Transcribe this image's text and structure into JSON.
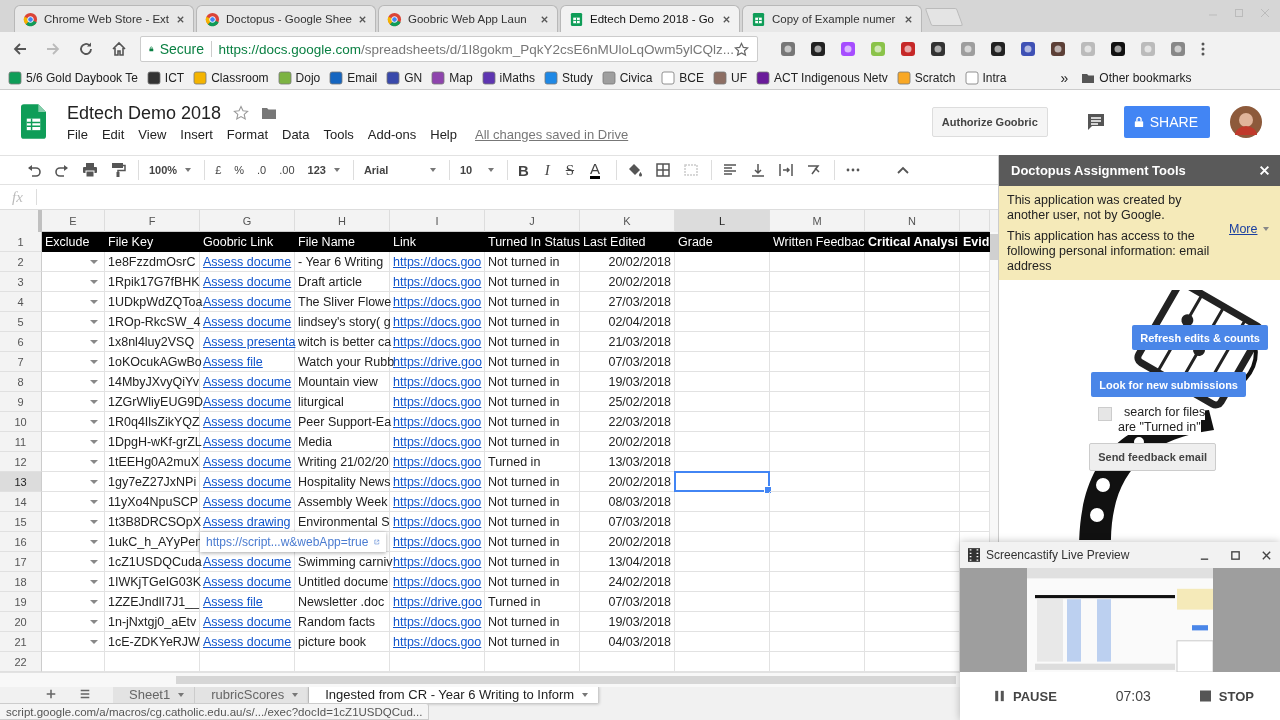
{
  "browser": {
    "tabs": [
      {
        "title": "Chrome Web Store - Ext",
        "kind": "store",
        "selected": false
      },
      {
        "title": "Doctopus - Google Shee",
        "kind": "store",
        "selected": false
      },
      {
        "title": "Goobric Web App Laun",
        "kind": "store",
        "selected": false
      },
      {
        "title": "Edtech Demo 2018 - Go",
        "kind": "sheets",
        "selected": true
      },
      {
        "title": "Copy of Example numer",
        "kind": "sheets",
        "selected": false
      }
    ],
    "address": {
      "secure_label": "Secure",
      "url_host": "https://docs.google.com",
      "url_path": "/spreadsheets/d/1I8gokm_PqkY2csE6nMUloLqOwm5ylCQlz..."
    },
    "bookmarks": [
      {
        "label": "5/6 Gold Daybook Te",
        "color": "#0f9d58"
      },
      {
        "label": "ICT",
        "color": "#333333"
      },
      {
        "label": "Classroom",
        "color": "#f4b400"
      },
      {
        "label": "Dojo",
        "color": "#7cb342"
      },
      {
        "label": "Email",
        "color": "#1565c0"
      },
      {
        "label": "GN",
        "color": "#3949ab"
      },
      {
        "label": "Map",
        "color": "#8e44ad"
      },
      {
        "label": "iMaths",
        "color": "#5e35b1"
      },
      {
        "label": "Study",
        "color": "#1e88e5"
      },
      {
        "label": "Civica",
        "color": "#9e9e9e"
      },
      {
        "label": "BCE",
        "color": "#ffffff"
      },
      {
        "label": "UF",
        "color": "#8d6e63"
      },
      {
        "label": "ACT Indigenous Netv",
        "color": "#6a1b9a"
      },
      {
        "label": "Scratch",
        "color": "#f9a825"
      },
      {
        "label": "Intra",
        "color": "#ffffff"
      }
    ],
    "bookmarks_more": "»",
    "other_bookmarks": "Other bookmarks"
  },
  "doc": {
    "title": "Edtech Demo 2018",
    "menu": [
      "File",
      "Edit",
      "View",
      "Insert",
      "Format",
      "Data",
      "Tools",
      "Add-ons",
      "Help"
    ],
    "save_status": "All changes saved in Drive",
    "authorize_button": "Authorize Goobric",
    "share_button": "SHARE"
  },
  "toolbar": {
    "zoom": "100%",
    "currency": "£",
    "percent": "%",
    "decrease_decimals": ".0",
    "increase_decimals": ".00",
    "number_format": "123",
    "font": "Arial",
    "font_size": "10",
    "bold": "B",
    "italic": "I",
    "strikethrough": "S",
    "text_color": "A"
  },
  "formula_bar": {
    "label": "fx"
  },
  "sheet": {
    "columns": [
      {
        "letter": "E",
        "selected": false
      },
      {
        "letter": "F",
        "selected": false
      },
      {
        "letter": "G",
        "selected": false
      },
      {
        "letter": "H",
        "selected": false
      },
      {
        "letter": "I",
        "selected": false
      },
      {
        "letter": "J",
        "selected": false
      },
      {
        "letter": "K",
        "selected": false
      },
      {
        "letter": "L",
        "selected": true
      },
      {
        "letter": "M",
        "selected": false
      },
      {
        "letter": "N",
        "selected": false
      }
    ],
    "header": {
      "number": "1",
      "cells": [
        {
          "text": "Exclude",
          "bold": false
        },
        {
          "text": "File Key",
          "bold": false
        },
        {
          "text": "Goobric Link",
          "bold": false
        },
        {
          "text": "File Name",
          "bold": false
        },
        {
          "text": "Link",
          "bold": false
        },
        {
          "text": "Turned In Status",
          "bold": false
        },
        {
          "text": "Last Edited",
          "bold": false
        },
        {
          "text": "Grade",
          "bold": false
        },
        {
          "text": "Written Feedbac",
          "bold": false
        },
        {
          "text": "Critical Analysi",
          "bold": true
        },
        {
          "text": "Evid",
          "bold": true
        }
      ]
    },
    "rows": [
      {
        "number": "2",
        "selected": false,
        "file_key": "1e8FzzdmOsrC",
        "goobric_link": "Assess docume",
        "file_name": "- Year 6 Writing",
        "link": "https://docs.goo",
        "status": "Not turned in",
        "last_edited": "20/02/2018"
      },
      {
        "number": "3",
        "selected": false,
        "file_key": "1Rpik17G7fBHK",
        "goobric_link": "Assess docume",
        "file_name": "Draft article",
        "link": "https://docs.goo",
        "status": "Not turned in",
        "last_edited": "20/02/2018"
      },
      {
        "number": "4",
        "selected": false,
        "file_key": "1UDkpWdZQToa",
        "goobric_link": "Assess docume",
        "file_name": "The Sliver Flowe",
        "link": "https://docs.goo",
        "status": "Not turned in",
        "last_edited": "27/03/2018"
      },
      {
        "number": "5",
        "selected": false,
        "file_key": "1ROp-RkcSW_4",
        "goobric_link": "Assess docume",
        "file_name": "lindsey's story( g",
        "link": "https://docs.goo",
        "status": "Not turned in",
        "last_edited": "02/04/2018"
      },
      {
        "number": "6",
        "selected": false,
        "file_key": "1x8nl4luy2VSQ",
        "goobric_link": "Assess presenta",
        "file_name": "witch is better ca",
        "link": "https://docs.goo",
        "status": "Not turned in",
        "last_edited": "21/03/2018"
      },
      {
        "number": "7",
        "selected": false,
        "file_key": "1oKOcukAGwBo",
        "goobric_link": "Assess file",
        "file_name": "Watch your Rubb",
        "link": "https://drive.goo",
        "status": "Not turned in",
        "last_edited": "07/03/2018"
      },
      {
        "number": "8",
        "selected": false,
        "file_key": "14MbyJXvyQiYv",
        "goobric_link": "Assess docume",
        "file_name": "Mountain view",
        "link": "https://docs.goo",
        "status": "Not turned in",
        "last_edited": "19/03/2018"
      },
      {
        "number": "9",
        "selected": false,
        "file_key": "1ZGrWliyEUG9D",
        "goobric_link": "Assess docume",
        "file_name": "liturgical",
        "link": "https://docs.goo",
        "status": "Not turned in",
        "last_edited": "25/02/2018"
      },
      {
        "number": "10",
        "selected": false,
        "file_key": "1R0q4IlsZikYQZ",
        "goobric_link": "Assess docume",
        "file_name": "Peer Support-Ea",
        "link": "https://docs.goo",
        "status": "Not turned in",
        "last_edited": "22/03/2018"
      },
      {
        "number": "11",
        "selected": false,
        "file_key": "1DpgH-wKf-grZL",
        "goobric_link": "Assess docume",
        "file_name": "Media",
        "link": "https://docs.goo",
        "status": "Not turned in",
        "last_edited": "20/02/2018"
      },
      {
        "number": "12",
        "selected": false,
        "file_key": "1tEEHg0A2muX",
        "goobric_link": "Assess docume",
        "file_name": "Writing 21/02/20",
        "link": "https://docs.goo",
        "status": "Turned in",
        "last_edited": "13/03/2018"
      },
      {
        "number": "13",
        "selected": true,
        "file_key": "1gy7eZ27JxNPi",
        "goobric_link": "Assess docume",
        "file_name": "Hospitality News",
        "link": "https://docs.goo",
        "status": "Not turned in",
        "last_edited": "20/02/2018"
      },
      {
        "number": "14",
        "selected": false,
        "file_key": "11yXo4NpuSCP",
        "goobric_link": "Assess docume",
        "file_name": "Assembly Week",
        "link": "https://docs.goo",
        "status": "Not turned in",
        "last_edited": "08/03/2018"
      },
      {
        "number": "15",
        "selected": false,
        "file_key": "1t3B8DRCSOpX",
        "goobric_link": "Assess drawing",
        "file_name": "Environmental S",
        "link": "https://docs.goo",
        "status": "Not turned in",
        "last_edited": "07/03/2018"
      },
      {
        "number": "16",
        "selected": false,
        "file_key": "1ukC_h_AYyPen",
        "link": "https://docs.goo",
        "status": "Not turned in",
        "last_edited": "20/02/2018"
      },
      {
        "number": "17",
        "selected": false,
        "file_key": "1cZ1USDQCuda",
        "goobric_link": "Assess docume",
        "file_name": "Swimming carniv",
        "link": "https://docs.goo",
        "status": "Not turned in",
        "last_edited": "13/04/2018"
      },
      {
        "number": "18",
        "selected": false,
        "file_key": "1IWKjTGeIG03K",
        "goobric_link": "Assess docume",
        "file_name": "Untitled docume",
        "link": "https://docs.goo",
        "status": "Not turned in",
        "last_edited": "24/02/2018"
      },
      {
        "number": "19",
        "selected": false,
        "file_key": "1ZZEJndlI7J1__",
        "goobric_link": "Assess file",
        "file_name": "Newsletter .doc",
        "link": "https://drive.goo",
        "status": "Turned in",
        "last_edited": "07/03/2018"
      },
      {
        "number": "20",
        "selected": false,
        "file_key": "1n-jNxtgj0_aEtv",
        "goobric_link": "Assess docume",
        "file_name": "Random facts",
        "link": "https://docs.goo",
        "status": "Not turned in",
        "last_edited": "19/03/2018"
      },
      {
        "number": "21",
        "selected": false,
        "file_key": "1cE-ZDKYeRJW",
        "goobric_link": "Assess docume",
        "file_name": "picture book",
        "link": "https://docs.goo",
        "status": "Not turned in",
        "last_edited": "04/03/2018"
      }
    ],
    "empty_rows": [
      "22"
    ],
    "link_popup": {
      "url": "https://script...w&webApp=true"
    }
  },
  "sheet_tabs": [
    {
      "label": "Sheet1",
      "selected": false
    },
    {
      "label": "rubricScores",
      "selected": false
    },
    {
      "label": "Ingested from CR - Year 6 Writing to Inform",
      "selected": true
    }
  ],
  "status_url": "script.google.com/a/macros/cg.catholic.edu.au/s/.../exec?docId=1cZ1USDQCud...",
  "side_panel": {
    "title": "Doctopus Assignment Tools",
    "notice": [
      "This application was created by another user, not by Google.",
      "This application has access to the following personal information: email address"
    ],
    "more_link": "More",
    "refresh_button": "Refresh edits & counts",
    "submissions_button": "Look for new submissions",
    "turned_in_option": {
      "lines": [
        "search for files",
        "are \"Turned in\""
      ],
      "checked": false
    },
    "feedback_button": "Send feedback email"
  },
  "recorder": {
    "title": "Screencastify Live Preview",
    "pause": "PAUSE",
    "time": "07:03",
    "stop": "STOP"
  }
}
